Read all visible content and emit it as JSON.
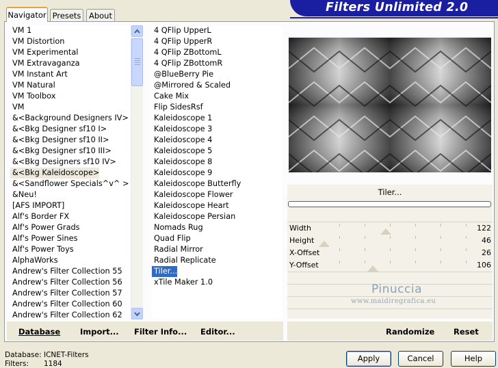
{
  "app": {
    "title": "Filters Unlimited 2.0"
  },
  "tabs": [
    {
      "label": "Navigator",
      "active": true
    },
    {
      "label": "Presets",
      "active": false
    },
    {
      "label": "About",
      "active": false
    }
  ],
  "categories": {
    "items": [
      "VM 1",
      "VM Distortion",
      "VM Experimental",
      "VM Extravaganza",
      "VM Instant Art",
      "VM Natural",
      "VM Toolbox",
      "VM",
      "&<Background Designers IV>",
      "&<Bkg Designer sf10 I>",
      "&<Bkg Designer sf10 II>",
      "&<Bkg Designer sf10 III>",
      "&<Bkg Designers sf10 IV>",
      "&<Bkg Kaleidoscope>",
      "&<Sandflower Specials^v^ >",
      "&Neu!",
      "[AFS IMPORT]",
      "Alf's Border FX",
      "Alf's Power Grads",
      "Alf's Power Sines",
      "Alf's Power Toys",
      "AlphaWorks",
      "Andrew's Filter Collection 55",
      "Andrew's Filter Collection 56",
      "Andrew's Filter Collection 57",
      "Andrew's Filter Collection 60",
      "Andrew's Filter Collection 62"
    ],
    "highlighted": "&<Bkg Kaleidoscope>"
  },
  "filters": {
    "items": [
      "4 QFlip UpperL",
      "4 QFlip UpperR",
      "4 QFlip ZBottomL",
      "4 QFlip ZBottomR",
      "@BlueBerry Pie",
      "@Mirrored & Scaled",
      "Cake Mix",
      "Flip SidesRsf",
      "Kaleidoscope 1",
      "Kaleidoscope 3",
      "Kaleidoscope 4",
      "Kaleidoscope 5",
      "Kaleidoscope 8",
      "Kaleidoscope 9",
      "Kaleidoscope Butterfly",
      "Kaleidoscope Flower",
      "Kaleidoscope Heart",
      "Kaleidoscope Persian",
      "Nomads Rug",
      "Quad Flip",
      "Radial Mirror",
      "Radial Replicate",
      "Tiler...",
      "xTile Maker 1.0"
    ],
    "selected": "Tiler..."
  },
  "preview": {
    "filter_name": "Tiler...",
    "progress": 0
  },
  "params": [
    {
      "label": "Width",
      "value": "122",
      "slider": 0.48
    },
    {
      "label": "Height",
      "value": "46",
      "slider": 0.18
    },
    {
      "label": "X-Offset",
      "value": "26",
      "slider": null
    },
    {
      "label": "Y-Offset",
      "value": "106",
      "slider": 0.42
    }
  ],
  "watermark": {
    "name": "Pinuccia",
    "url": "www.maidiregrafica.eu"
  },
  "toolbar": {
    "database": "Database",
    "import": "Import...",
    "filter_info": "Filter Info...",
    "editor": "Editor...",
    "randomize": "Randomize",
    "reset": "Reset"
  },
  "status": {
    "database_label": "Database:",
    "database_value": "ICNET-Filters",
    "filters_label": "Filters:",
    "filters_value": "1184"
  },
  "dialog": {
    "apply": "Apply",
    "cancel": "Cancel",
    "help": "Help"
  },
  "colors": {
    "banner": "#1a1ea0",
    "selection": "#316ac5",
    "highlight": "#ede9dc"
  }
}
